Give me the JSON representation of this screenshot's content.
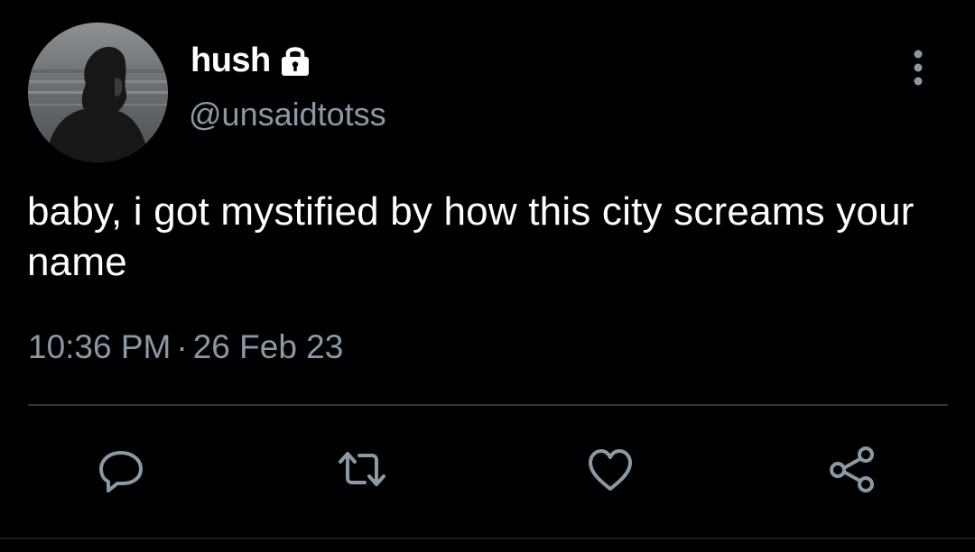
{
  "author": {
    "display_name": "hush",
    "handle": "@unsaidtotss",
    "protected_icon": "lock-icon",
    "avatar": "avatar-photo"
  },
  "tweet": {
    "text": "baby, i got mystified by how this city screams your name",
    "time": "10:36 PM",
    "separator": "·",
    "date": "26 Feb 23"
  },
  "actions": [
    {
      "name": "reply",
      "icon": "speech-bubble-icon"
    },
    {
      "name": "retweet",
      "icon": "retweet-icon"
    },
    {
      "name": "like",
      "icon": "heart-icon"
    },
    {
      "name": "share",
      "icon": "share-icon"
    }
  ],
  "colors": {
    "background": "#000000",
    "primary_text": "#ffffff",
    "secondary_text": "#8b98a5",
    "icon": "#8b98a5",
    "divider": "#2f3336"
  }
}
